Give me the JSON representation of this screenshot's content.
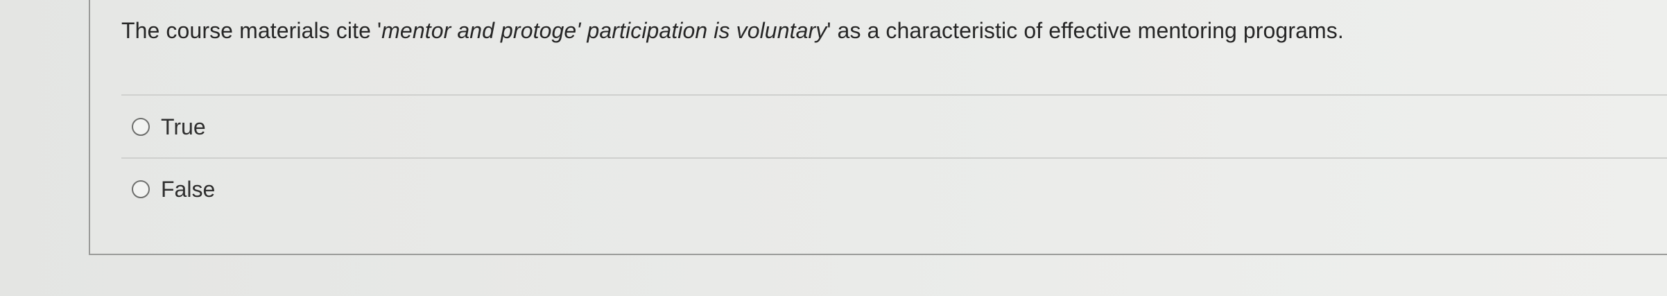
{
  "question": {
    "prefix": "The course materials cite '",
    "quoted": "mentor and protoge' participation is voluntary",
    "suffix": "' as a characteristic of effective mentoring programs."
  },
  "options": [
    {
      "label": "True",
      "selected": false
    },
    {
      "label": "False",
      "selected": false
    }
  ]
}
